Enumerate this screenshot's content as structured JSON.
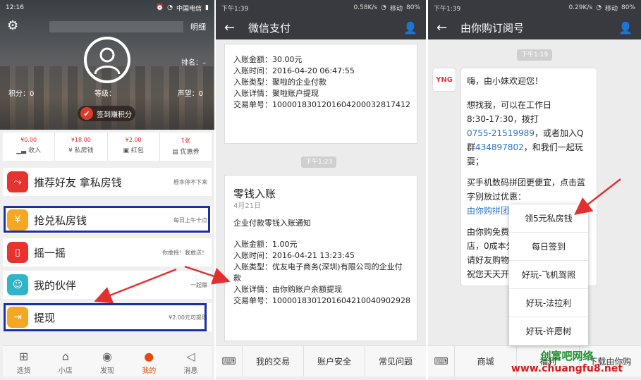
{
  "p1": {
    "status": {
      "time": "12:16",
      "carrier": "中国电信"
    },
    "detail_label": "明细",
    "rank": "排名：–",
    "points": "积分：0",
    "level": "等级：",
    "reputation": "声望：0",
    "checkin": "签到赚积分",
    "wallet": [
      {
        "amount": "¥0.00",
        "label": "收入",
        "icon": "chart-icon"
      },
      {
        "amount": "¥18.00",
        "label": "私房钱",
        "icon": "coin-icon"
      },
      {
        "amount": "¥2.00",
        "label": "红包",
        "icon": "gift-icon"
      },
      {
        "amount": "1张",
        "label": "优惠券",
        "icon": "coupon-icon"
      }
    ],
    "menu": [
      {
        "title": "推荐好友 拿私房钱",
        "hint": "根本停不下来",
        "color": "#e8322d",
        "icon": "share-icon"
      },
      {
        "title": "抢兑私房钱",
        "hint": "每日上午十点",
        "color": "#f5a623",
        "icon": "money-bag-icon"
      },
      {
        "title": "摇一摇",
        "hint": "你敢摇！我敢送！",
        "color": "#e8322d",
        "icon": "phone-shake-icon"
      },
      {
        "title": "我的伙伴",
        "hint": "一起赚",
        "color": "#2fb5c8",
        "icon": "partner-icon"
      },
      {
        "title": "提现",
        "hint": "¥2.00元可提现",
        "color": "#f5a623",
        "icon": "withdraw-icon"
      }
    ],
    "tabs": [
      "选货",
      "小店",
      "发现",
      "我的",
      "消息"
    ]
  },
  "p2": {
    "status": {
      "time": "下午1:39",
      "speed": "0.58K/s",
      "carrier": "移动",
      "battery": "80%"
    },
    "title": "微信支付",
    "card1": [
      "入账金额：30.00元",
      "入账时间：2016-04-20 06:47:55",
      "入账类型：聚啦的企业付款",
      "入账详情：聚啦账户提现",
      "交易单号：1000018301201604200032817412"
    ],
    "time2": "下午1:23",
    "card2_title": "零钱入账",
    "card2_date": "4月21日",
    "card2_notice": "企业付款零钱入账通知",
    "card2": [
      "入账金额：1.00元",
      "入账时间：2016-04-21 13:23:45",
      "入账类型：优友电子商务(深圳)有限公司的企业付款",
      "入账详情：由你购账户余额提现",
      "交易单号：1000018301201604210040902928"
    ],
    "bottom": [
      "我的交易",
      "账户安全",
      "常见问题"
    ]
  },
  "p3": {
    "status": {
      "time": "下午1:39",
      "speed": "0.29K/s",
      "carrier": "移动",
      "battery": "80%"
    },
    "title": "由你购订阅号",
    "time": "下午1:19",
    "logo": "YNG",
    "msg": {
      "greet": "嗨，由小妹欢迎您！",
      "l1": "想找我，可以在工作日",
      "l2": "8:30-17:30，拨打",
      "phone": "0755-21519989",
      "l3": "，或者加入Q",
      "l4": "群",
      "qq": "434897802",
      "l5": "，和我们一起玩耍；",
      "l6": "买手机数码拼团更便宜，点击蓝字别放过优惠：",
      "link": "由你购拼团",
      "l7": "由你购免费",
      "l8": "店，0成本分",
      "l9": "请好友购物",
      "l10": "祝您天天开"
    },
    "popup": [
      "领5元私房钱",
      "每日签到",
      "好玩-飞机驾照",
      "好玩-法拉利",
      "好玩-许愿树"
    ],
    "bottom": [
      "商城",
      "福利",
      "下载由你购"
    ],
    "watermark1": "创富吧网络",
    "watermark2": "www.chuangfu8.net"
  }
}
